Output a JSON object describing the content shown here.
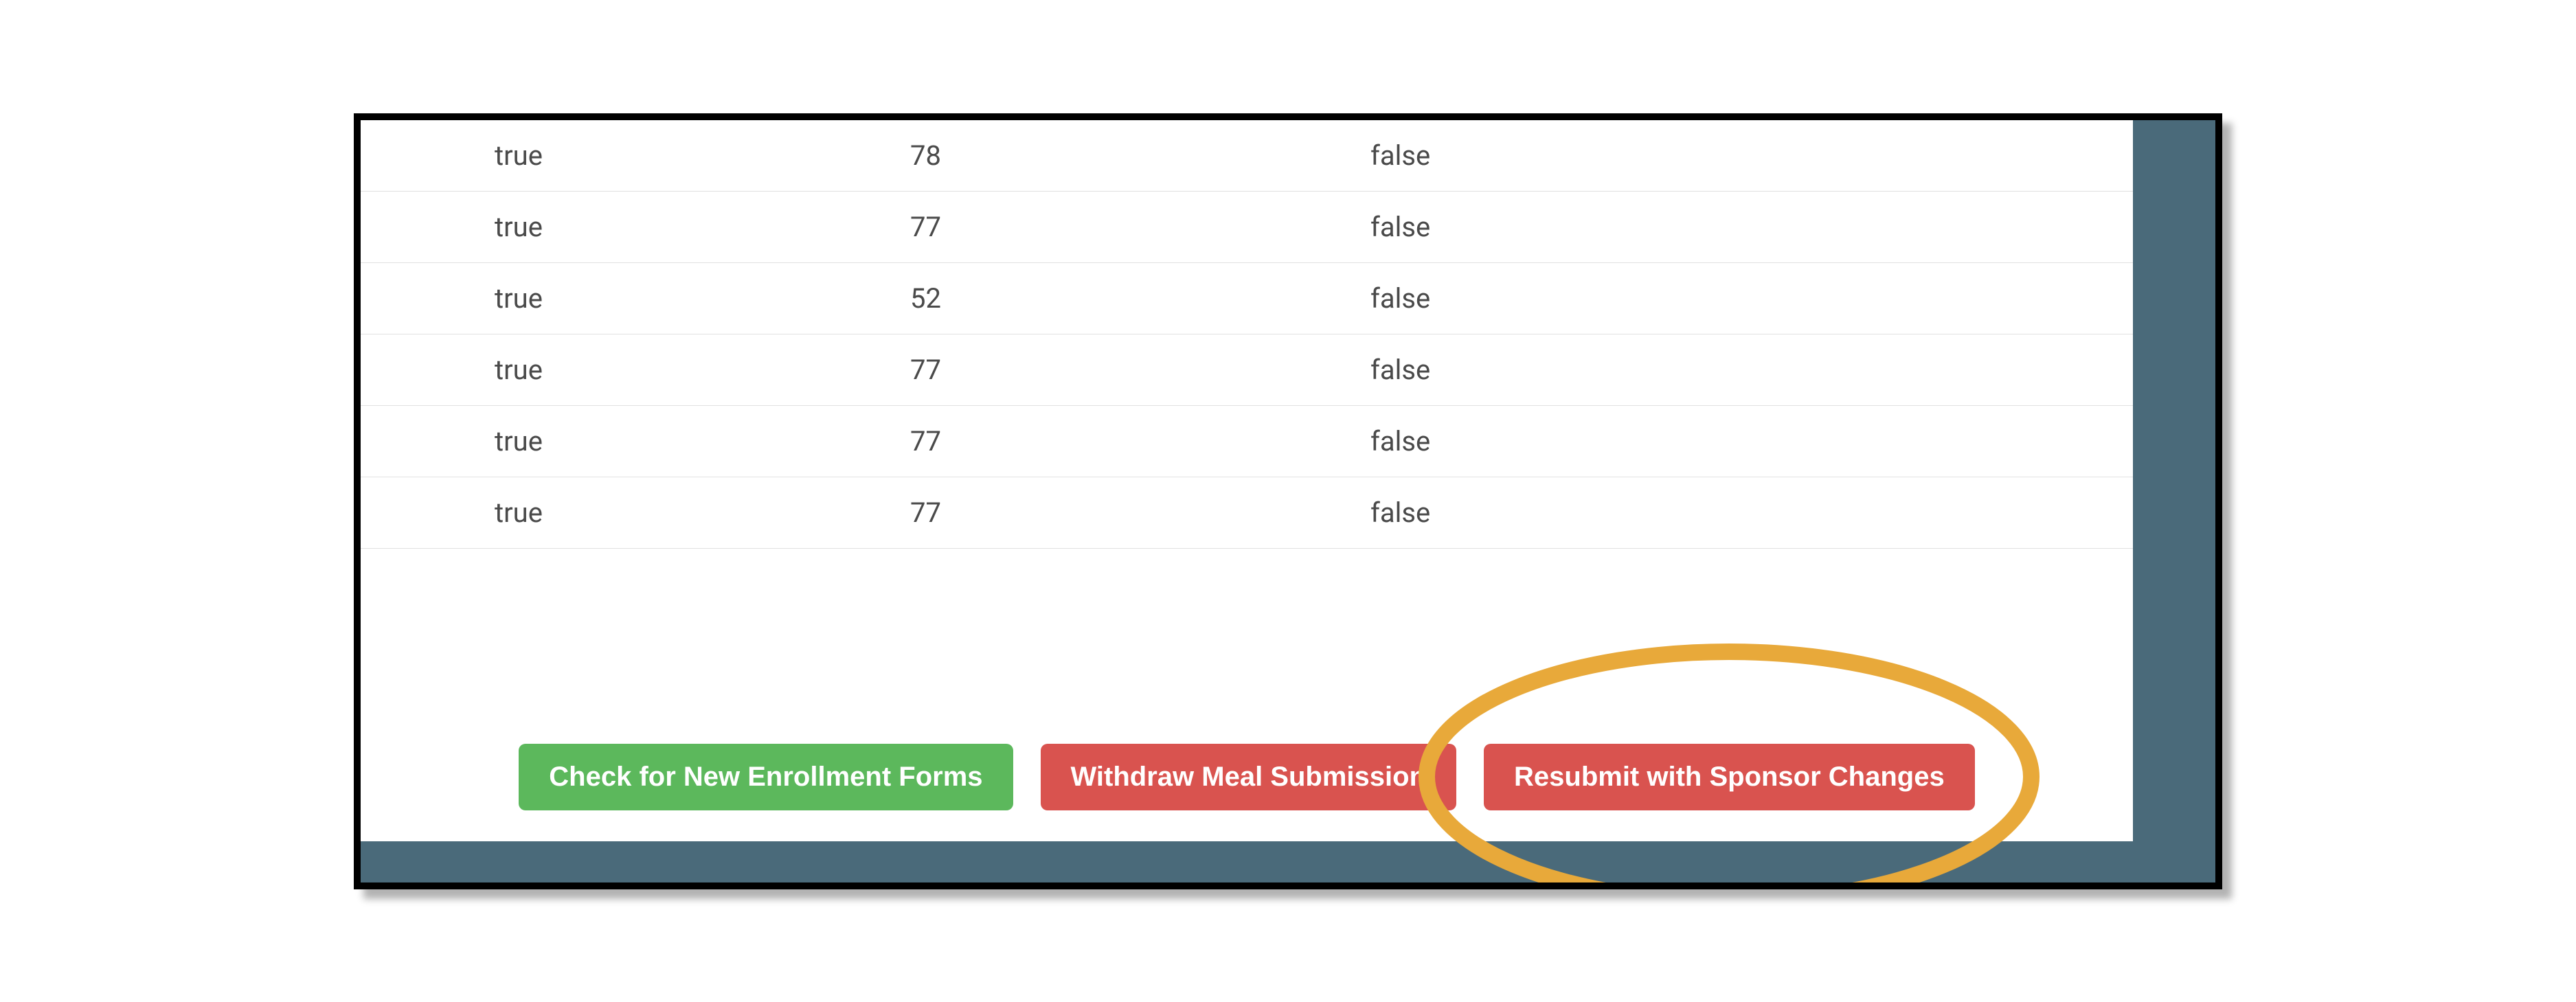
{
  "table": {
    "rows": [
      {
        "col1": "true",
        "col2": "78",
        "col3": "false"
      },
      {
        "col1": "true",
        "col2": "77",
        "col3": "false"
      },
      {
        "col1": "true",
        "col2": "52",
        "col3": "false"
      },
      {
        "col1": "true",
        "col2": "77",
        "col3": "false"
      },
      {
        "col1": "true",
        "col2": "77",
        "col3": "false"
      },
      {
        "col1": "true",
        "col2": "77",
        "col3": "false"
      }
    ]
  },
  "buttons": {
    "check_enrollment": "Check for New Enrollment Forms",
    "withdraw": "Withdraw Meal Submission",
    "resubmit": "Resubmit with Sponsor Changes"
  },
  "colors": {
    "green": "#5cb85c",
    "red": "#d9534f",
    "frame_bg": "#4a6a7a",
    "annotation": "#e8a93a"
  }
}
